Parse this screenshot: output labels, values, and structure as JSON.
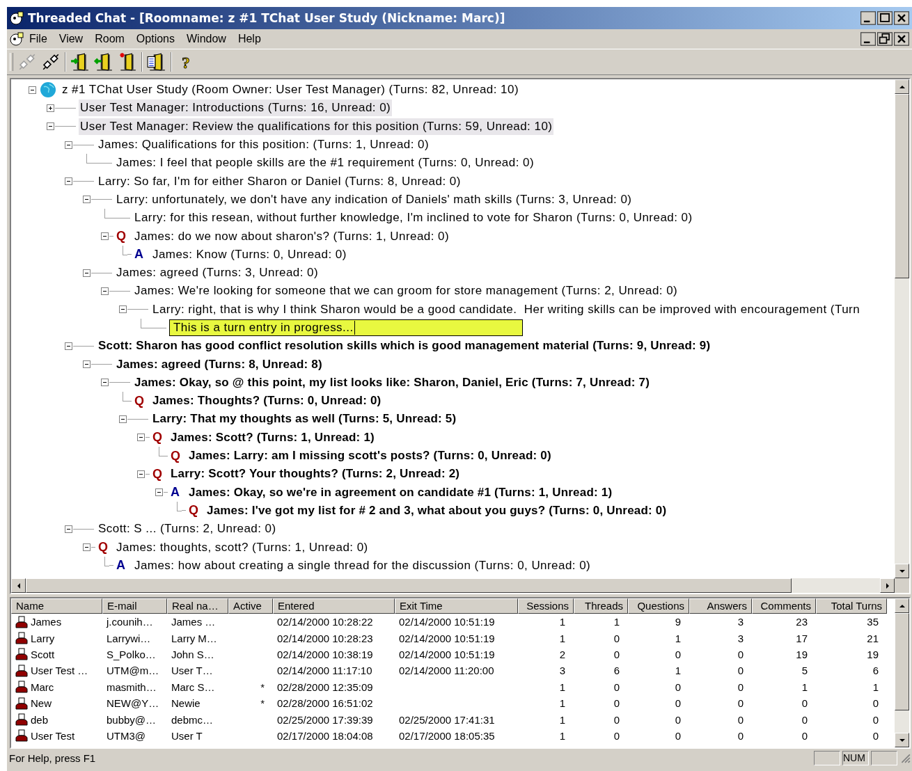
{
  "window": {
    "title": "Threaded Chat - [Roomname: z #1 TChat User Study (Nickname: Marc)]"
  },
  "menu": [
    "File",
    "View",
    "Room",
    "Options",
    "Window",
    "Help"
  ],
  "toolbar": [
    {
      "kind": "plug",
      "disabled": true
    },
    {
      "kind": "plug",
      "disabled": false
    },
    {
      "kind": "door-in",
      "disabled": false
    },
    {
      "kind": "door-out",
      "disabled": false
    },
    {
      "kind": "door-new",
      "disabled": false
    },
    {
      "kind": "door-list",
      "disabled": false
    },
    {
      "kind": "help",
      "glyph": "?",
      "disabled": false
    }
  ],
  "tree": {
    "kind": "root",
    "text": "z #1 TChat User Study (Room Owner: User Test Manager) (Turns: 82, Unread: 10)",
    "expanded": true,
    "children": [
      {
        "text": "User Test Manager: Introductions (Turns: 16, Unread: 0)",
        "expanded": false,
        "highlighted": true
      },
      {
        "text": "User Test Manager: Review the qualifications for this position (Turns: 59, Unread: 10)",
        "expanded": true,
        "highlighted": true,
        "children": [
          {
            "text": "James: Qualifications for this position: (Turns: 1, Unread: 0)",
            "expanded": true,
            "children": [
              {
                "text": "James: I feel that people skills are the #1 requirement (Turns: 0, Unread: 0)"
              }
            ]
          },
          {
            "text": "Larry: So far, I'm for either Sharon or Daniel (Turns: 8, Unread: 0)",
            "expanded": true,
            "children": [
              {
                "text": "Larry: unfortunately, we don't have any indication of Daniels' math skills (Turns: 3, Unread: 0)",
                "expanded": true,
                "children": [
                  {
                    "text": "Larry: for this resean, without further knowledge, I'm inclined to vote for Sharon (Turns: 0, Unread: 0)"
                  },
                  {
                    "kind": "question",
                    "marker": "Q",
                    "text": "James: do we now about sharon's? (Turns: 1, Unread: 0)",
                    "expanded": true,
                    "children": [
                      {
                        "kind": "answer",
                        "marker": "A",
                        "text": "James: Know (Turns: 0, Unread: 0)"
                      }
                    ]
                  }
                ]
              },
              {
                "text": "James: agreed (Turns: 3, Unread: 0)",
                "expanded": true,
                "children": [
                  {
                    "text": "James: We're looking for someone that we can groom for store management (Turns: 2, Unread: 0)",
                    "expanded": true,
                    "children": [
                      {
                        "text": "Larry: right, that is why I think Sharon would be a good candidate.  Her writing skills can be improved with encouragement (Turn",
                        "expanded": true,
                        "children": [
                          {
                            "kind": "entry",
                            "text": "This is a turn entry in progress..."
                          }
                        ]
                      }
                    ]
                  }
                ]
              }
            ]
          },
          {
            "unread": true,
            "text": "Scott: Sharon has good conflict resolution skills which is good management material (Turns: 9, Unread: 9)",
            "expanded": true,
            "children": [
              {
                "unread": true,
                "text": "James: agreed (Turns: 8, Unread: 8)",
                "expanded": true,
                "children": [
                  {
                    "unread": true,
                    "text": "James: Okay, so @ this point, my list looks like: Sharon, Daniel, Eric (Turns: 7, Unread: 7)",
                    "expanded": true,
                    "children": [
                      {
                        "kind": "question",
                        "marker": "Q",
                        "unread": true,
                        "text": "James: Thoughts? (Turns: 0, Unread: 0)"
                      },
                      {
                        "unread": true,
                        "text": "Larry: That my thoughts as well (Turns: 5, Unread: 5)",
                        "expanded": true,
                        "children": [
                          {
                            "kind": "question",
                            "marker": "Q",
                            "unread": true,
                            "text": "James: Scott? (Turns: 1, Unread: 1)",
                            "expanded": true,
                            "children": [
                              {
                                "kind": "question",
                                "marker": "Q",
                                "unread": true,
                                "text": "James: Larry: am I missing scott's posts? (Turns: 0, Unread: 0)"
                              }
                            ]
                          },
                          {
                            "kind": "question",
                            "marker": "Q",
                            "unread": true,
                            "text": "Larry: Scott? Your thoughts? (Turns: 2, Unread: 2)",
                            "expanded": true,
                            "children": [
                              {
                                "kind": "answer",
                                "marker": "A",
                                "unread": true,
                                "text": "James: Okay, so we're in agreement on candidate #1 (Turns: 1, Unread: 1)",
                                "expanded": true,
                                "children": [
                                  {
                                    "kind": "question",
                                    "marker": "Q",
                                    "unread": true,
                                    "text": "James: I've got my list for # 2 and 3, what about you guys? (Turns: 0, Unread: 0)"
                                  }
                                ]
                              }
                            ]
                          }
                        ]
                      }
                    ]
                  }
                ]
              }
            ]
          },
          {
            "text": "Scott: S ... (Turns: 2, Unread: 0)",
            "expanded": true,
            "children": [
              {
                "kind": "question",
                "marker": "Q",
                "text": "James: thoughts, scott? (Turns: 1, Unread: 0)",
                "expanded": true,
                "children": [
                  {
                    "kind": "answer",
                    "marker": "A",
                    "text": "James: how about creating a single thread for the discussion (Turns: 0, Unread: 0)"
                  }
                ]
              }
            ]
          }
        ]
      }
    ]
  },
  "users": {
    "columns": [
      "Name",
      "E-mail",
      "Real na…",
      "Active",
      "Entered",
      "Exit Time",
      "Sessions",
      "Threads",
      "Questions",
      "Answers",
      "Comments",
      "Total Turns"
    ],
    "rows": [
      [
        "James",
        "j.counih…",
        "James …",
        "",
        "02/14/2000 10:28:22",
        "02/14/2000 10:51:19",
        "1",
        "1",
        "9",
        "3",
        "23",
        "35"
      ],
      [
        "Larry",
        "Larrywi…",
        "Larry M…",
        "",
        "02/14/2000 10:28:23",
        "02/14/2000 10:51:19",
        "1",
        "0",
        "1",
        "3",
        "17",
        "21"
      ],
      [
        "Scott",
        "S_Polko…",
        "John S…",
        "",
        "02/14/2000 10:38:19",
        "02/14/2000 10:51:19",
        "2",
        "0",
        "0",
        "0",
        "19",
        "19"
      ],
      [
        "User Test …",
        "UTM@m…",
        "User T…",
        "",
        "02/14/2000 11:17:10",
        "02/14/2000 11:20:00",
        "3",
        "6",
        "1",
        "0",
        "5",
        "6"
      ],
      [
        "Marc",
        "masmith…",
        "Marc S…",
        "*",
        "02/28/2000 12:35:09",
        "",
        "1",
        "0",
        "0",
        "0",
        "1",
        "1"
      ],
      [
        "New",
        "NEW@Y…",
        "Newie",
        "*",
        "02/28/2000 16:51:02",
        "",
        "1",
        "0",
        "0",
        "0",
        "0",
        "0"
      ],
      [
        "deb",
        "bubby@…",
        "debmc…",
        "",
        "02/25/2000 17:39:39",
        "02/25/2000 17:41:31",
        "1",
        "0",
        "0",
        "0",
        "0",
        "0"
      ],
      [
        "User Test",
        "UTM3@",
        "User T",
        "",
        "02/17/2000 18:04:08",
        "02/17/2000 18:05:35",
        "1",
        "0",
        "0",
        "0",
        "0",
        "0"
      ]
    ]
  },
  "status_bar": {
    "text": "For Help, press F1",
    "panes": [
      "NUM"
    ]
  }
}
